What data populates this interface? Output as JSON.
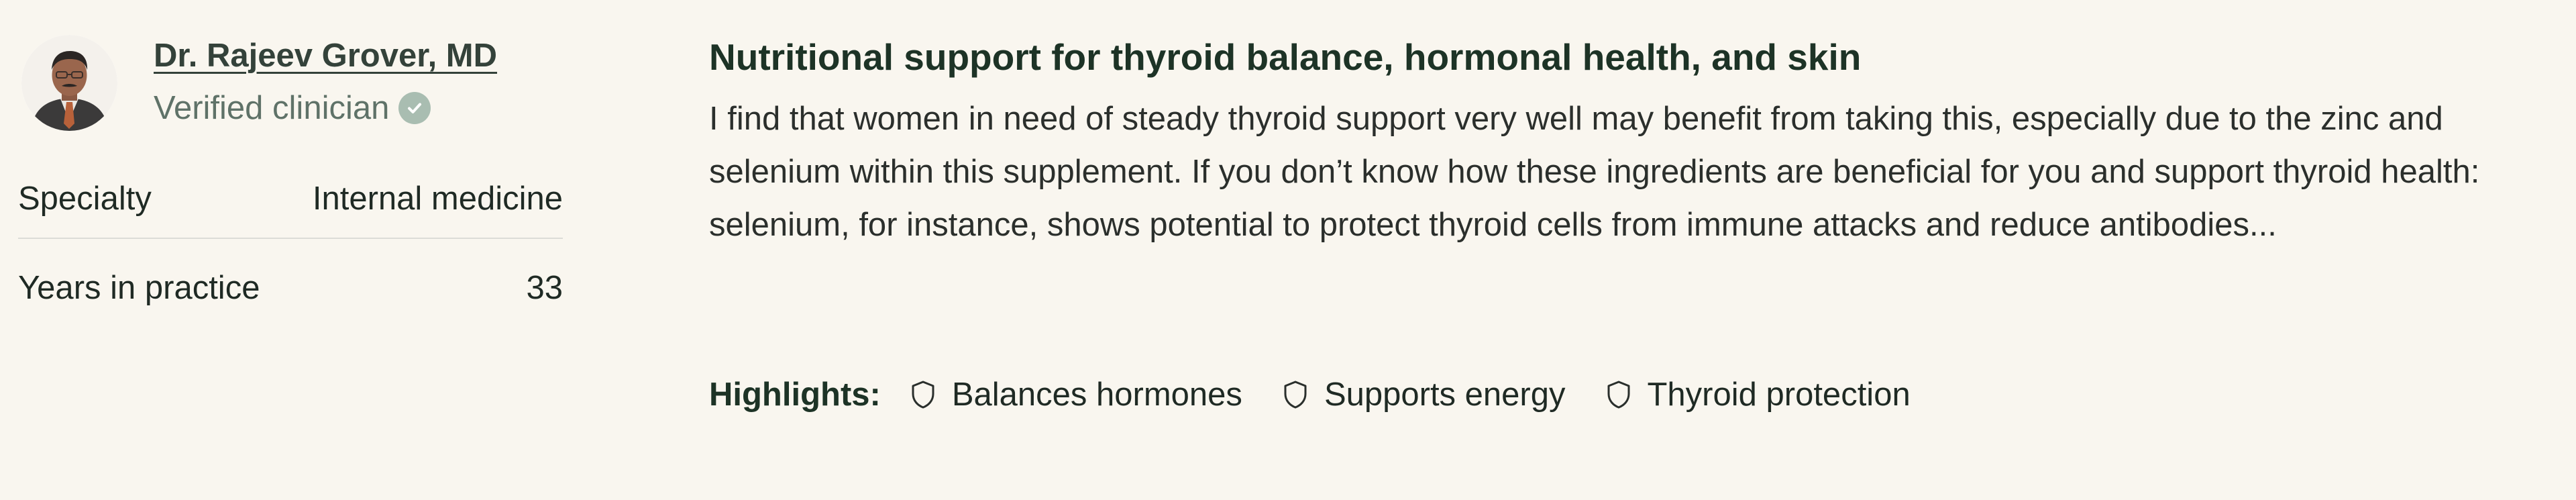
{
  "doctor": {
    "name": "Dr. Rajeev Grover, MD",
    "status": "Verified clinician",
    "status_icon": "check-circle-icon"
  },
  "details": [
    {
      "label": "Specialty",
      "value": "Internal medicine"
    },
    {
      "label": "Years in practice",
      "value": "33"
    }
  ],
  "review": {
    "title": "Nutritional support for thyroid balance, hormonal health, and skin",
    "body": "I find that women in need of steady thyroid support very well may benefit from taking this, especially due to the zinc and selenium within this supplement. If you don’t know how these ingredients are beneficial for you and support thyroid health: selenium, for instance, shows potential to protect thyroid cells from immune attacks and reduce antibodies..."
  },
  "highlights": {
    "label": "Highlights:",
    "icon": "shield-icon",
    "items": [
      "Balances hormones",
      "Supports energy",
      "Thyroid protection"
    ]
  },
  "colors": {
    "background": "#f9f6ef",
    "heading": "#1d3326",
    "verified_badge": "#a9bdb1"
  }
}
